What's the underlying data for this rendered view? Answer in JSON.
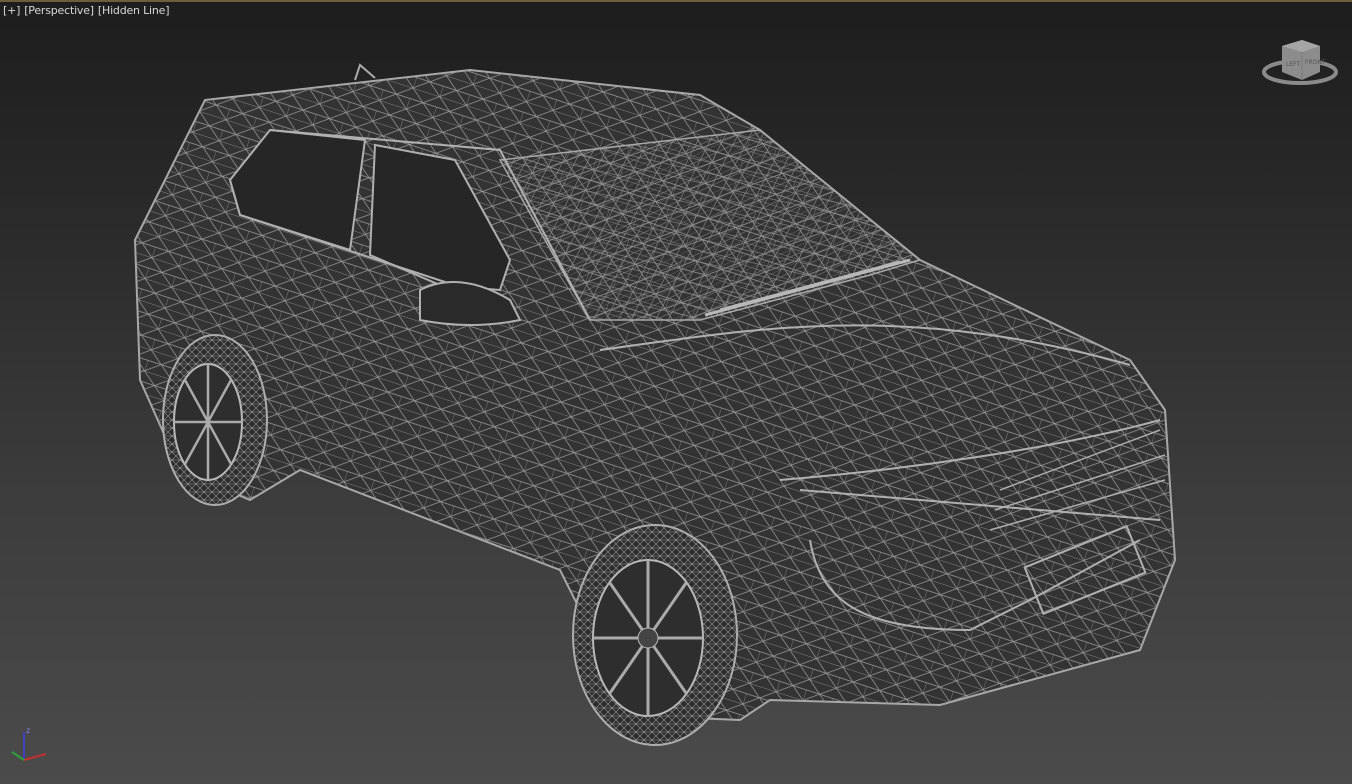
{
  "viewport": {
    "menu_label": "[+]",
    "view_label": "[Perspective]",
    "shading_label": "[Hidden Line]"
  },
  "viewcube": {
    "left_face": "LEFT",
    "front_face": "FRONT"
  },
  "axis_gizmo": {
    "z_label": "z"
  },
  "colors": {
    "wire": "#a0a0a0",
    "background_top": "#1d1d1d",
    "background_bottom": "#4b4b4b",
    "x_axis": "#c03030",
    "y_axis": "#30a040",
    "z_axis": "#4040c0"
  }
}
